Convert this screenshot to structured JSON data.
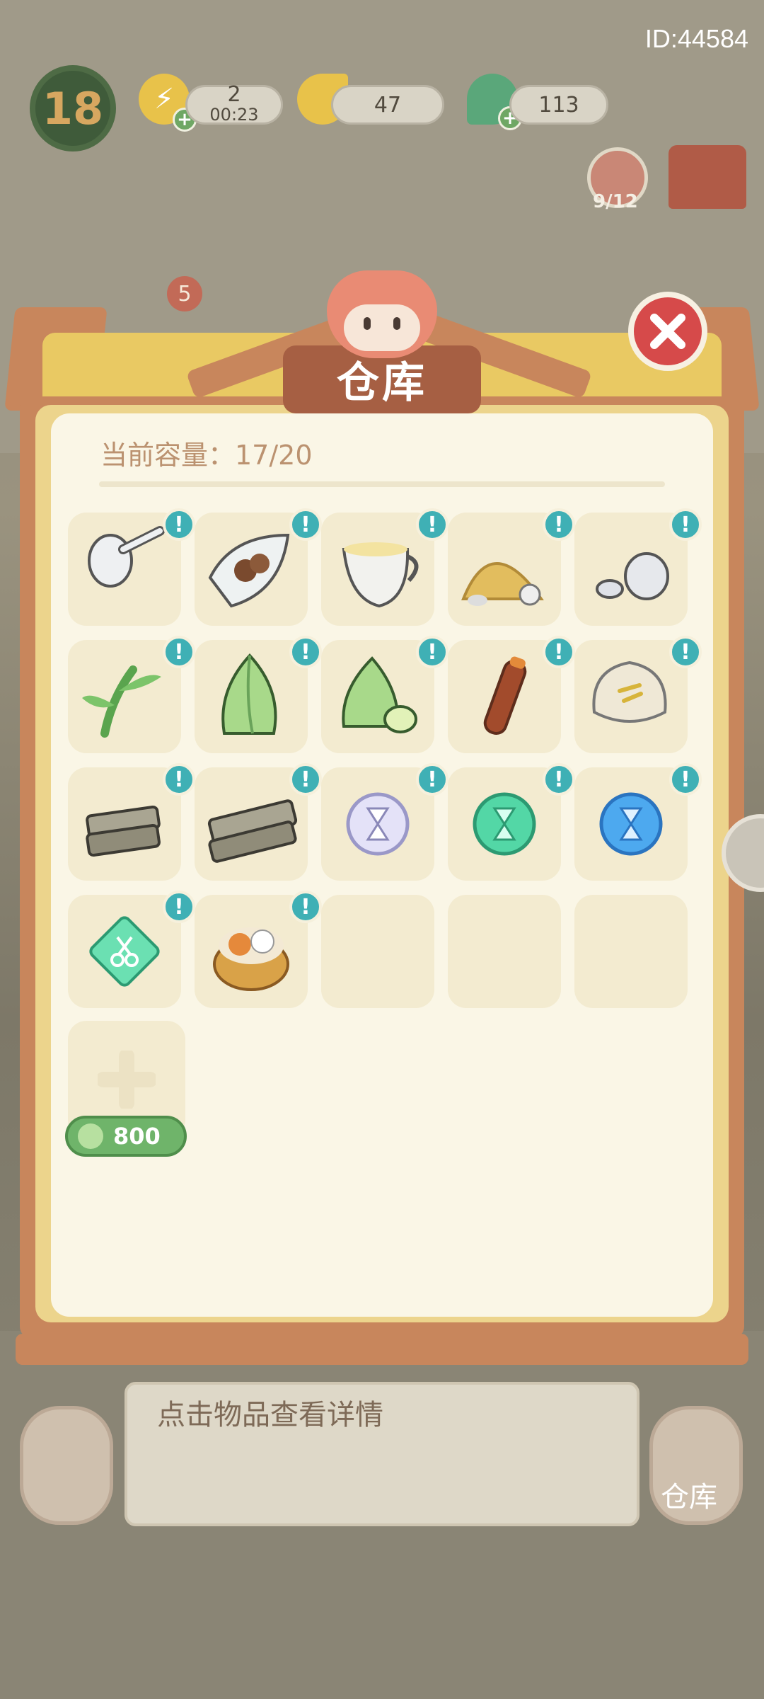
{
  "id_label": "ID:44584",
  "hud": {
    "level": "18",
    "energy": {
      "value": "2",
      "timer": "00:23",
      "icon": "lightning-icon"
    },
    "leaf": {
      "value": "47",
      "icon": "ginkgo-leaf-icon"
    },
    "drop": {
      "value": "113",
      "icon": "green-drop-icon"
    },
    "guest_count": "9/12",
    "background_badge": "5"
  },
  "panel": {
    "title": "仓库",
    "capacity": "当前容量：17/20",
    "badge_mark": "!",
    "expand_price": "800",
    "items": [
      {
        "name": "spoon",
        "icon": "porcelain-spoon-icon"
      },
      {
        "name": "tea-seeds",
        "icon": "tea-seed-bag-icon"
      },
      {
        "name": "milk-jug",
        "icon": "milk-jug-icon"
      },
      {
        "name": "sand-pile",
        "icon": "sand-pile-icon"
      },
      {
        "name": "stones",
        "icon": "stones-icon"
      },
      {
        "name": "bamboo-branch",
        "icon": "bamboo-branch-icon"
      },
      {
        "name": "bamboo-shoot",
        "icon": "bamboo-shoot-icon"
      },
      {
        "name": "bamboo-shoots-sliced",
        "icon": "sliced-bamboo-shoot-icon"
      },
      {
        "name": "bamboo-tube",
        "icon": "bamboo-tube-icon"
      },
      {
        "name": "flour-sack",
        "icon": "flour-sack-icon"
      },
      {
        "name": "wood-planks-small",
        "icon": "wood-planks-icon"
      },
      {
        "name": "wood-planks-large",
        "icon": "wood-board-icon"
      },
      {
        "name": "hourglass-white",
        "icon": "white-hourglass-coin-icon"
      },
      {
        "name": "hourglass-green",
        "icon": "green-hourglass-coin-icon"
      },
      {
        "name": "hourglass-blue",
        "icon": "blue-hourglass-coin-icon"
      },
      {
        "name": "scissors-card",
        "icon": "scissors-card-icon"
      },
      {
        "name": "hedgehog-basket",
        "icon": "hedgehog-basket-icon"
      }
    ],
    "empty_slots": 3
  },
  "footer": {
    "hint": "点击物品查看详情",
    "right_button": "仓库"
  },
  "colors": {
    "badge": "#3fb0b5",
    "close_button": "#d64a4a",
    "price_pill": "#6fb46a",
    "paper": "#faf6e6",
    "frame": "#c8865c"
  }
}
